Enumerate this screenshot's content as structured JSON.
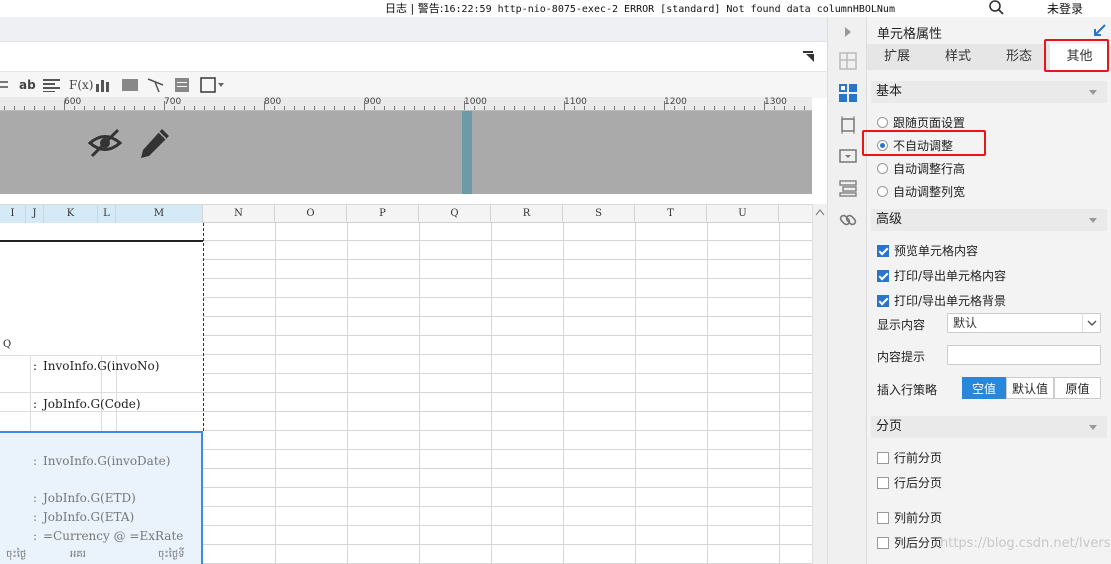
{
  "topbar": {
    "log_label": "日志",
    "separator": "|",
    "warn_prefix": "警告:",
    "warn_msg": "16:22:59 http-nio-8075-exec-2 ERROR [standard] Not found data columnHBOLNum",
    "login": "未登录"
  },
  "toolbar": {
    "ab_label": "ab",
    "fx_label": "F(x)"
  },
  "ruler": {
    "labels": [
      "600",
      "700",
      "800",
      "900",
      "1000",
      "1100",
      "1200",
      "1300"
    ]
  },
  "columns": [
    "I",
    "J",
    "K",
    "L",
    "M",
    "N",
    "O",
    "P",
    "Q",
    "R",
    "S",
    "T",
    "U"
  ],
  "cells": {
    "colon1": ":",
    "invo_no": "InvoInfo.G(invoNo)",
    "colon2": ":",
    "job_code": "JobInfo.G(Code)",
    "colon3": ":",
    "invo_date": "InvoInfo.G(invoDate)",
    "colon4": ":",
    "etd": "JobInfo.G(ETD)",
    "colon5": ":",
    "eta": "JobInfo.G(ETA)",
    "colon6": ":",
    "currency": "=Currency @ =ExRate",
    "footer_a": "ចុះថ្ងៃ",
    "footer_b": "អគរ",
    "footer_c": "ចុះថ្ងៃទី"
  },
  "panel": {
    "title": "单元格属性",
    "tabs": [
      "扩展",
      "样式",
      "形态",
      "其他"
    ],
    "active_tab": "其他",
    "sec_basic": "基本",
    "basic_options": [
      "跟随页面设置",
      "不自动调整",
      "自动调整行高",
      "自动调整列宽"
    ],
    "basic_selected": 1,
    "sec_advanced": "高级",
    "adv_checks": [
      "预览单元格内容",
      "打印/导出单元格内容",
      "打印/导出单元格背景"
    ],
    "display_label": "显示内容",
    "display_value": "默认",
    "tip_label": "内容提示",
    "insert_label": "插入行策略",
    "insert_options": [
      "空值",
      "默认值",
      "原值"
    ],
    "insert_selected": 0,
    "sec_page": "分页",
    "page_checks": [
      "行前分页",
      "行后分页",
      "列前分页",
      "列后分页"
    ]
  },
  "watermark": "https://blog.csdn.net/lversons",
  "colors": {
    "accent": "#2a86d8",
    "highlight": "#e8161b",
    "selection": "#3f8ae0"
  }
}
